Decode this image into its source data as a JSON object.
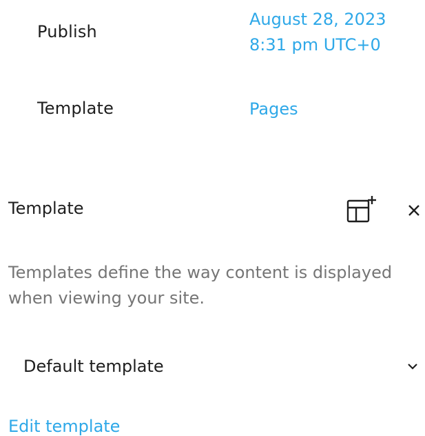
{
  "summary": {
    "publish": {
      "label": "Publish",
      "date_line": "August 28, 2023",
      "time_line": "8:31 pm UTC+0"
    },
    "template": {
      "label": "Template",
      "value": "Pages"
    }
  },
  "template_panel": {
    "title": "Template",
    "description": "Templates define the way content is displayed when viewing your site.",
    "selected_template": "Default template",
    "edit_link": "Edit template",
    "icons": {
      "create": "add-template-icon",
      "close": "close-icon",
      "chevron": "chevron-down-icon"
    }
  },
  "colors": {
    "accent": "#2ea8e8",
    "text": "#1e1e1e",
    "muted_text": "#757575"
  }
}
